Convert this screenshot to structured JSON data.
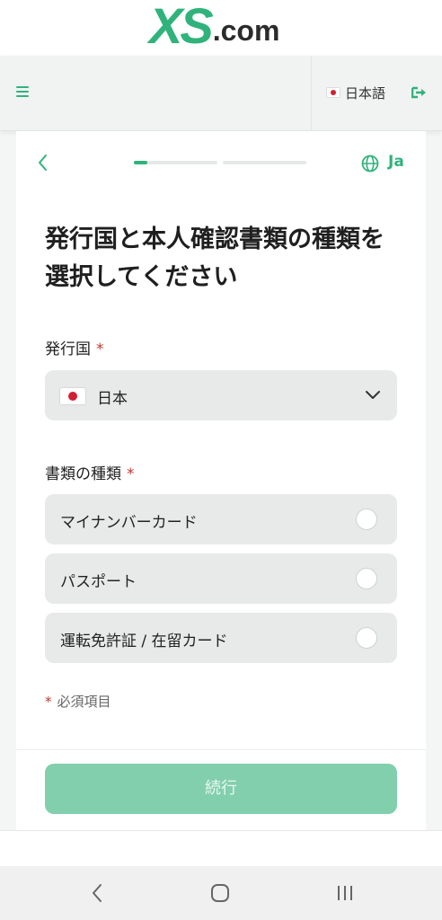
{
  "brand": {
    "logo_main": "XS",
    "logo_suffix": ".com",
    "accent_color": "#2fb37b"
  },
  "navbar": {
    "menu_icon": "hamburger-icon",
    "language_label": "日本語",
    "logout_icon": "logout-icon"
  },
  "wizard": {
    "back_icon": "chevron-left-icon",
    "progress_fraction": 0.08,
    "progress_steps": 2,
    "language_icon": "globe-icon",
    "language_code": "Ja"
  },
  "form": {
    "title": "発行国と本人確認書類の種類を選択してください",
    "country_label": "発行国",
    "required_mark": "*",
    "country_value": "日本",
    "doc_type_label": "書類の種類",
    "options": [
      {
        "label": "マイナンバーカード",
        "selected": false
      },
      {
        "label": "パスポート",
        "selected": false
      },
      {
        "label": "運転免許証 / 在留カード",
        "selected": false
      }
    ],
    "required_note": "必須項目",
    "continue_label": "続行"
  },
  "colors": {
    "required": "#c0392b",
    "button_disabled": "#82cfae"
  }
}
